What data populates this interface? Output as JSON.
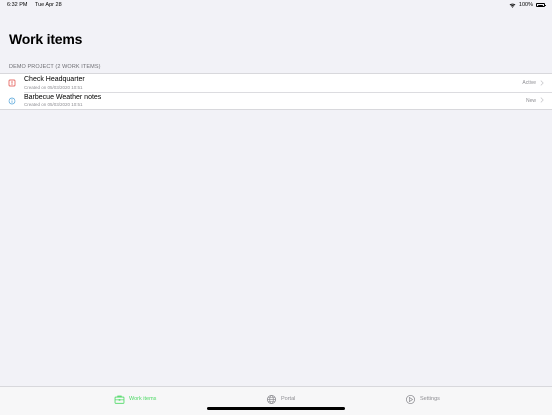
{
  "status_bar": {
    "time": "6:32 PM",
    "date": "Tue Apr 28",
    "battery": "100%"
  },
  "page": {
    "title": "Work items"
  },
  "section": {
    "header": "DEMO PROJECT (2 WORK ITEMS)"
  },
  "items": [
    {
      "title": "Check Headquarter",
      "subtitle": "Created on 05/03/2020 10:51",
      "status": "Active",
      "icon": "exclamation-icon",
      "icon_color": "#e0443e"
    },
    {
      "title": "Barbecue Weather notes",
      "subtitle": "Created on 05/03/2020 10:51",
      "status": "New",
      "icon": "info-icon",
      "icon_color": "#4a9fd8"
    }
  ],
  "tabs": [
    {
      "label": "Work items",
      "icon": "toolbox-icon",
      "active": true
    },
    {
      "label": "Portal",
      "icon": "globe-icon",
      "active": false
    },
    {
      "label": "Settings",
      "icon": "settings-icon",
      "active": false
    }
  ],
  "colors": {
    "accent": "#4cd964",
    "background": "#f2f2f7",
    "secondary_text": "#8e8e93"
  }
}
